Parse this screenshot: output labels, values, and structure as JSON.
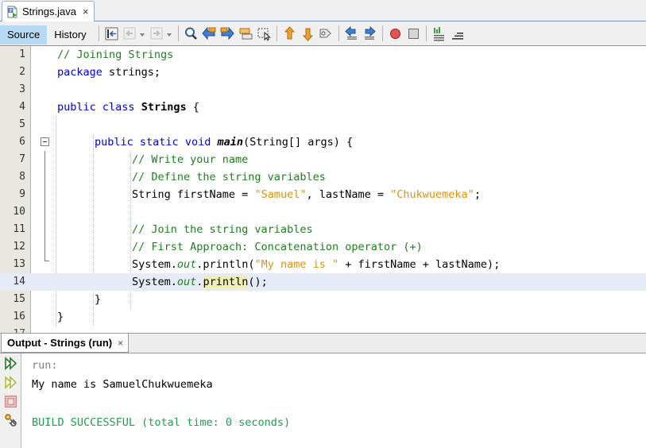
{
  "window": {
    "file_tab": {
      "label": "Strings.java",
      "close": "×",
      "icon": "java-file-icon"
    }
  },
  "toolbar": {
    "view_tabs": [
      {
        "label": "Source",
        "selected": true
      },
      {
        "label": "History",
        "selected": false
      }
    ],
    "icons": [
      {
        "name": "last-edit-icon",
        "group": 1
      },
      {
        "name": "back-icon",
        "group": 1
      },
      {
        "name": "forward-icon",
        "group": 1
      },
      {
        "name": "find-icon",
        "group": 2
      },
      {
        "name": "find-previous-icon",
        "group": 2
      },
      {
        "name": "find-next-icon",
        "group": 2
      },
      {
        "name": "toggle-highlight-icon",
        "group": 2
      },
      {
        "name": "toggle-rectangular-selection-icon",
        "group": 2
      },
      {
        "name": "shift-line-up-icon",
        "group": 3
      },
      {
        "name": "shift-line-down-icon",
        "group": 3
      },
      {
        "name": "comment-icon",
        "group": 3
      },
      {
        "name": "shift-left-icon",
        "group": 4
      },
      {
        "name": "shift-right-icon",
        "group": 4
      },
      {
        "name": "toggle-breakpoint-icon",
        "group": 5
      },
      {
        "name": "toggle-bookmark-icon",
        "group": 5
      },
      {
        "name": "inspect-members-icon",
        "group": 6
      },
      {
        "name": "inspect-hierarchy-icon",
        "group": 6
      }
    ]
  },
  "editor": {
    "lines": [
      {
        "num": "1",
        "indent": 0,
        "current": false,
        "fold": false,
        "guides": 0,
        "tokens": [
          {
            "t": "// Joining Strings",
            "c": "cm"
          }
        ]
      },
      {
        "num": "2",
        "indent": 0,
        "current": false,
        "fold": false,
        "guides": 0,
        "tokens": [
          {
            "t": "package",
            "c": "kw"
          },
          {
            "t": " strings;",
            "c": ""
          }
        ]
      },
      {
        "num": "3",
        "indent": 0,
        "current": false,
        "fold": false,
        "guides": 0,
        "tokens": []
      },
      {
        "num": "4",
        "indent": 0,
        "current": false,
        "fold": false,
        "guides": 0,
        "tokens": [
          {
            "t": "public",
            "c": "kw"
          },
          {
            "t": " ",
            "c": ""
          },
          {
            "t": "class",
            "c": "kw"
          },
          {
            "t": " ",
            "c": ""
          },
          {
            "t": "Strings",
            "c": "bold"
          },
          {
            "t": " {",
            "c": ""
          }
        ]
      },
      {
        "num": "5",
        "indent": 0,
        "current": false,
        "fold": false,
        "guides": 1,
        "tokens": []
      },
      {
        "num": "6",
        "indent": 1,
        "current": false,
        "fold": true,
        "guides": 1,
        "tokens": [
          {
            "t": "public",
            "c": "kw"
          },
          {
            "t": " ",
            "c": ""
          },
          {
            "t": "static",
            "c": "kw"
          },
          {
            "t": " ",
            "c": ""
          },
          {
            "t": "void",
            "c": "kw"
          },
          {
            "t": " ",
            "c": ""
          },
          {
            "t": "main",
            "c": "bold it"
          },
          {
            "t": "(String[] args) {",
            "c": ""
          }
        ]
      },
      {
        "num": "7",
        "indent": 2,
        "current": false,
        "fold": false,
        "guides": 2,
        "tokens": [
          {
            "t": "// Write your name",
            "c": "cm"
          }
        ]
      },
      {
        "num": "8",
        "indent": 2,
        "current": false,
        "fold": false,
        "guides": 2,
        "tokens": [
          {
            "t": "// Define the string variables",
            "c": "cm"
          }
        ]
      },
      {
        "num": "9",
        "indent": 2,
        "current": false,
        "fold": false,
        "guides": 2,
        "tokens": [
          {
            "t": "String firstName = ",
            "c": ""
          },
          {
            "t": "\"Samuel\"",
            "c": "st"
          },
          {
            "t": ", lastName = ",
            "c": ""
          },
          {
            "t": "\"Chukwuemeka\"",
            "c": "st"
          },
          {
            "t": ";",
            "c": ""
          }
        ]
      },
      {
        "num": "10",
        "indent": 2,
        "current": false,
        "fold": false,
        "guides": 2,
        "tokens": []
      },
      {
        "num": "11",
        "indent": 2,
        "current": false,
        "fold": false,
        "guides": 2,
        "tokens": [
          {
            "t": "// Join the string variables",
            "c": "cm"
          }
        ]
      },
      {
        "num": "12",
        "indent": 2,
        "current": false,
        "fold": false,
        "guides": 2,
        "tokens": [
          {
            "t": "// First Approach: Concatenation operator (+)",
            "c": "cm"
          }
        ]
      },
      {
        "num": "13",
        "indent": 2,
        "current": false,
        "fold": false,
        "guides": 2,
        "tokens": [
          {
            "t": "System.",
            "c": ""
          },
          {
            "t": "out",
            "c": "fld"
          },
          {
            "t": ".println(",
            "c": ""
          },
          {
            "t": "\"My name is \"",
            "c": "st"
          },
          {
            "t": " + firstName + lastName);",
            "c": ""
          }
        ]
      },
      {
        "num": "14",
        "indent": 2,
        "current": true,
        "fold": false,
        "guides": 2,
        "tokens": [
          {
            "t": "System.",
            "c": ""
          },
          {
            "t": "out",
            "c": "fld"
          },
          {
            "t": ".",
            "c": ""
          },
          {
            "t": "println",
            "c": "mark"
          },
          {
            "t": "();",
            "c": ""
          }
        ]
      },
      {
        "num": "15",
        "indent": 1,
        "current": false,
        "fold": false,
        "guides": 1,
        "tokens": [
          {
            "t": "}",
            "c": ""
          }
        ]
      },
      {
        "num": "16",
        "indent": 0,
        "current": false,
        "fold": false,
        "guides": 0,
        "tokens": [
          {
            "t": "}",
            "c": ""
          }
        ]
      }
    ]
  },
  "output": {
    "tab": {
      "label": "Output - Strings (run)",
      "close": "×"
    },
    "gutter_icons": [
      {
        "name": "run-icon"
      },
      {
        "name": "rerun-icon"
      },
      {
        "name": "stop-icon"
      },
      {
        "name": "clean-and-build-icon"
      }
    ],
    "lines": [
      {
        "text": "run:",
        "style": "o-run"
      },
      {
        "text": "My name is SamuelChukwuemeka",
        "style": "o-std"
      },
      {
        "text": " ",
        "style": "o-std"
      },
      {
        "text": "BUILD SUCCESSFUL (total time: 0 seconds)",
        "style": "o-ok"
      }
    ]
  },
  "colors": {
    "keyword": "#0000e6",
    "comment": "#1f7f1f",
    "string": "#e09010",
    "field": "#1f7f1f",
    "current_line": "#e6ecf7",
    "occurrence_highlight": "#efefb0",
    "build_success": "#1f9f50",
    "selected_tab": "#b8d9f3"
  }
}
